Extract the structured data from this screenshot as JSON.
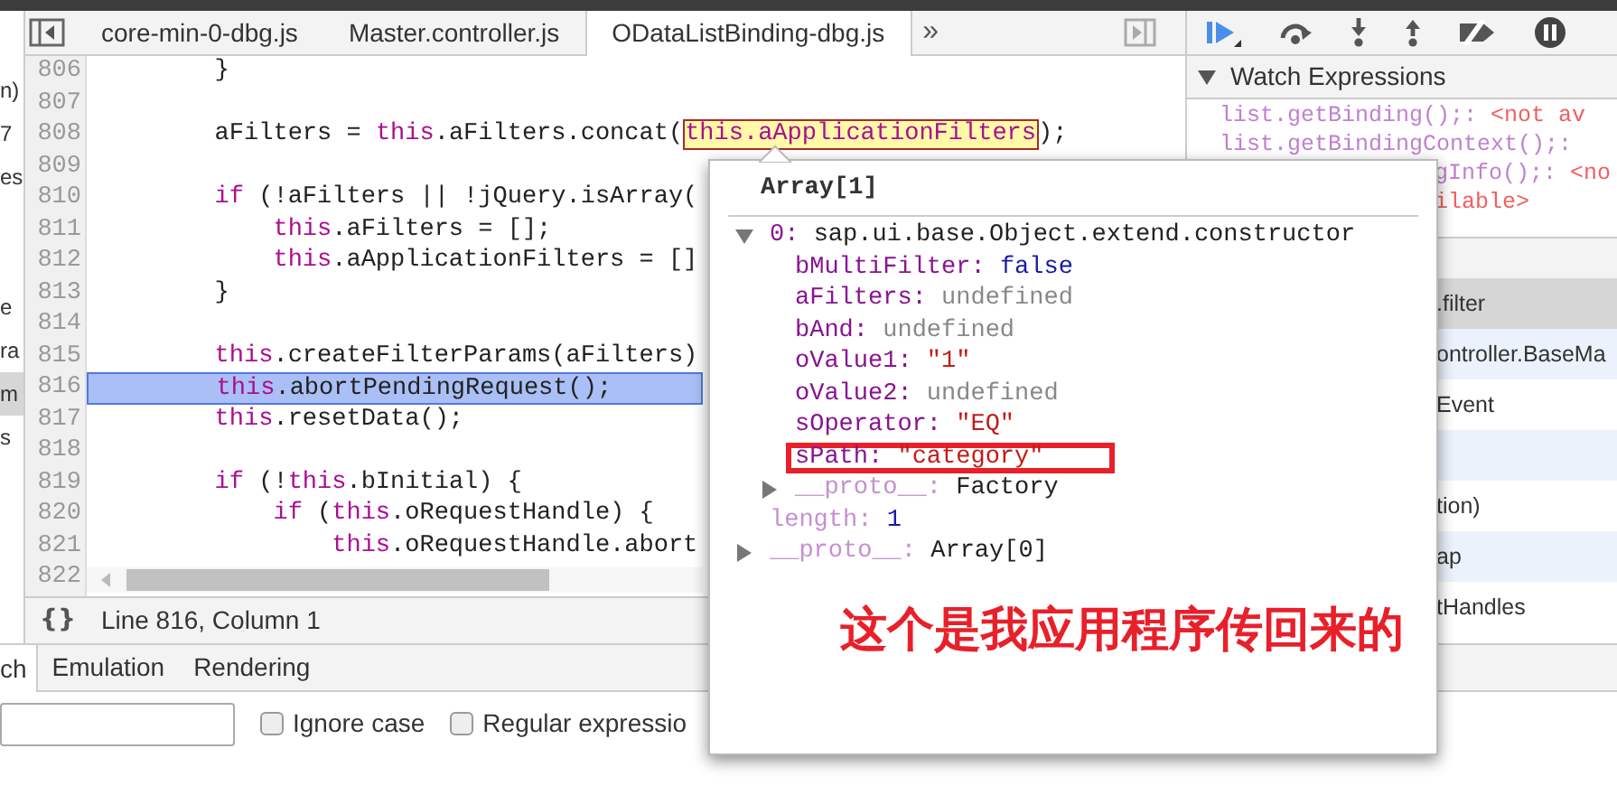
{
  "left_strip": [
    {
      "text": "n)",
      "selected": false
    },
    {
      "text": "7",
      "selected": false
    },
    {
      "text": "es",
      "selected": false
    },
    {
      "text": "e",
      "selected": false
    },
    {
      "text": "ra",
      "selected": false
    },
    {
      "text": "m",
      "selected": true
    },
    {
      "text": "s",
      "selected": false
    }
  ],
  "file_tabs": [
    {
      "label": "core-min-0-dbg.js",
      "selected": false
    },
    {
      "label": "Master.controller.js",
      "selected": false
    },
    {
      "label": "ODataListBinding-dbg.js",
      "selected": true
    }
  ],
  "more_tabs": "»",
  "code_lines": [
    {
      "number": "806",
      "selected": false,
      "code": [
        {
          "kind": "plain",
          "text": "        }"
        }
      ]
    },
    {
      "number": "807",
      "selected": false
    },
    {
      "number": "808",
      "selected": false,
      "code": [
        {
          "kind": "plain",
          "text": "        aFilters = "
        },
        {
          "kind": "keyword",
          "text": "this"
        },
        {
          "kind": "plain",
          "text": ".aFilters.concat("
        },
        {
          "kind": "hover",
          "text": "this.aApplicationFilters"
        },
        {
          "kind": "plain",
          "text": ");"
        }
      ]
    },
    {
      "number": "809",
      "selected": false
    },
    {
      "number": "810",
      "selected": false,
      "code": [
        {
          "kind": "keyword",
          "text": "        if"
        },
        {
          "kind": "plain",
          "text": " (!aFilters || !jQuery.isArray("
        }
      ]
    },
    {
      "number": "811",
      "selected": false,
      "code": [
        {
          "kind": "keyword",
          "text": "            this"
        },
        {
          "kind": "plain",
          "text": ".aFilters = [];"
        }
      ]
    },
    {
      "number": "812",
      "selected": false,
      "code": [
        {
          "kind": "keyword",
          "text": "            this"
        },
        {
          "kind": "plain",
          "text": ".aApplicationFilters = []"
        }
      ]
    },
    {
      "number": "813",
      "selected": false,
      "code": [
        {
          "kind": "plain",
          "text": "        }"
        }
      ]
    },
    {
      "number": "814",
      "selected": false
    },
    {
      "number": "815",
      "selected": false,
      "code": [
        {
          "kind": "keyword",
          "text": "        this"
        },
        {
          "kind": "plain",
          "text": ".createFilterParams(aFilters)"
        }
      ]
    },
    {
      "number": "816",
      "selected": true,
      "code": [
        {
          "kind": "keyword",
          "text": "        this"
        },
        {
          "kind": "plain",
          "text": ".abortPendingRequest();"
        }
      ]
    },
    {
      "number": "817",
      "selected": false,
      "code": [
        {
          "kind": "keyword",
          "text": "        this"
        },
        {
          "kind": "plain",
          "text": ".resetData();"
        }
      ]
    },
    {
      "number": "818",
      "selected": false
    },
    {
      "number": "819",
      "selected": false,
      "code": [
        {
          "kind": "keyword",
          "text": "        if"
        },
        {
          "kind": "plain",
          "text": " (!"
        },
        {
          "kind": "keyword",
          "text": "this"
        },
        {
          "kind": "plain",
          "text": ".bInitial) {"
        }
      ]
    },
    {
      "number": "820",
      "selected": false,
      "code": [
        {
          "kind": "keyword",
          "text": "            if"
        },
        {
          "kind": "plain",
          "text": " ("
        },
        {
          "kind": "keyword",
          "text": "this"
        },
        {
          "kind": "plain",
          "text": ".oRequestHandle) {"
        }
      ]
    },
    {
      "number": "821",
      "selected": false,
      "code": [
        {
          "kind": "keyword",
          "text": "                this"
        },
        {
          "kind": "plain",
          "text": ".oRequestHandle.abort"
        }
      ]
    },
    {
      "number": "822",
      "selected": false
    }
  ],
  "status_bar": {
    "pretty_print": "{}",
    "position": "Line 816, Column 1"
  },
  "watch": {
    "title": "Watch Expressions",
    "expanded": true,
    "lines": [
      {
        "kind": "full",
        "expression": "list.getBinding();: ",
        "value": "<not av"
      },
      {
        "kind": "full",
        "expression": "list.getBindingContext();:"
      },
      {
        "kind": "partial",
        "expression": "gInfo();: ",
        "value": "<no"
      },
      {
        "kind": "partial",
        "value": "ilable>"
      }
    ]
  },
  "call_stack": [
    {
      "text": ".filter",
      "selected": true
    },
    {
      "text": "ontroller.BaseMa",
      "selected": false
    },
    {
      "text": "Event",
      "selected": false
    },
    {
      "selected": false
    },
    {
      "text": "tion)",
      "selected": false
    },
    {
      "text": "ap",
      "selected": false
    },
    {
      "text": "tHandles",
      "selected": false
    }
  ],
  "drawer_tabs": [
    {
      "label": "ch",
      "selected": true
    },
    {
      "label": "Emulation",
      "selected": false
    },
    {
      "label": "Rendering",
      "selected": false
    }
  ],
  "search_options": [
    {
      "label": "Ignore case",
      "checked": false
    },
    {
      "label": "Regular expressio",
      "checked": false
    }
  ],
  "popover": {
    "title": "Array[1]",
    "items": [
      {
        "key": "0:",
        "value": "sap.ui.base.Object.extend.constructor",
        "color": "#222222",
        "dim": false,
        "expanded": true,
        "annotated": false,
        "children": [
          {
            "key": "bMultiFilter:",
            "value": "false",
            "color": "#1a1aa6",
            "dim": false,
            "annotated": false
          },
          {
            "key": "aFilters:",
            "value": "undefined",
            "color": "#888888",
            "dim": false,
            "annotated": false
          },
          {
            "key": "bAnd:",
            "value": "undefined",
            "color": "#888888",
            "dim": false,
            "annotated": false
          },
          {
            "key": "oValue1:",
            "value": "\"1\"",
            "color": "#c41a16",
            "dim": false,
            "annotated": false
          },
          {
            "key": "oValue2:",
            "value": "undefined",
            "color": "#888888",
            "dim": false,
            "annotated": false
          },
          {
            "key": "sOperator:",
            "value": "\"EQ\"",
            "color": "#c41a16",
            "dim": false,
            "annotated": false
          },
          {
            "key": "sPath:",
            "value": "\"category\"",
            "color": "#c41a16",
            "dim": false,
            "annotated": true
          },
          {
            "key": "__proto__:",
            "value": "Factory",
            "color": "#222222",
            "dim": true,
            "expanded": false,
            "annotated": false
          }
        ]
      },
      {
        "key": "length:",
        "value": "1",
        "color": "#1a1aa6",
        "dim": true,
        "annotated": false
      },
      {
        "key": "__proto__:",
        "value": "Array[0]",
        "color": "#222222",
        "dim": true,
        "expanded": false,
        "annotated": false
      }
    ],
    "note": "这个是我应用程序传回来的"
  }
}
